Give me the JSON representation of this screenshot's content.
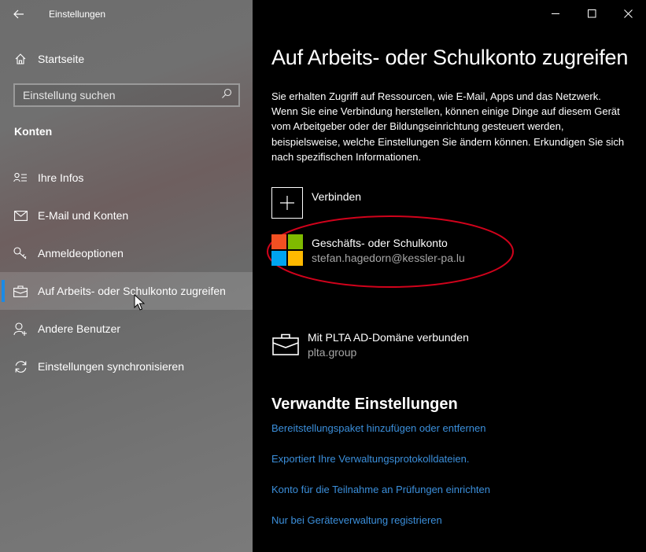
{
  "window": {
    "app_title": "Einstellungen",
    "controls": {
      "minimize": "minimize-icon",
      "maximize": "maximize-icon",
      "close": "close-icon"
    }
  },
  "sidebar": {
    "home_label": "Startseite",
    "search": {
      "placeholder": "Einstellung suchen",
      "value": ""
    },
    "section_heading": "Konten",
    "items": [
      {
        "label": "Ihre Infos",
        "icon": "user-info-icon",
        "selected": false
      },
      {
        "label": "E-Mail und Konten",
        "icon": "mail-icon",
        "selected": false
      },
      {
        "label": "Anmeldeoptionen",
        "icon": "key-icon",
        "selected": false
      },
      {
        "label": "Auf Arbeits- oder Schulkonto zugreifen",
        "icon": "briefcase-icon",
        "selected": true
      },
      {
        "label": "Andere Benutzer",
        "icon": "add-user-icon",
        "selected": false
      },
      {
        "label": "Einstellungen synchronisieren",
        "icon": "sync-icon",
        "selected": false
      }
    ]
  },
  "main": {
    "title": "Auf Arbeits- oder Schulkonto zugreifen",
    "description": "Sie erhalten Zugriff auf Ressourcen, wie E-Mail, Apps und das Netzwerk. Wenn Sie eine Verbindung herstellen, können einige Dinge auf diesem Gerät vom Arbeitgeber oder der Bildungseinrichtung gesteuert werden, beispielsweise, welche Einstellungen Sie ändern können. Erkundigen Sie sich nach spezifischen Informationen.",
    "connect_label": "Verbinden",
    "account": {
      "name": "Geschäfts- oder Schulkonto",
      "email": "stefan.hagedorn@kessler-pa.lu"
    },
    "domain": {
      "name": "Mit PLTA AD-Domäne verbunden",
      "sub": "plta.group"
    },
    "related_heading": "Verwandte Einstellungen",
    "links": [
      "Bereitstellungspaket hinzufügen oder entfernen",
      "Exportiert Ihre Verwaltungsprotokolldateien.",
      "Konto für die Teilnahme an Prüfungen einrichten",
      "Nur bei Geräteverwaltung registrieren"
    ]
  },
  "colors": {
    "accent": "#1a8ae6",
    "link": "#3b8fdb",
    "highlight_ellipse": "#d0021b",
    "ms_red": "#f25022",
    "ms_green": "#7fba00",
    "ms_blue": "#00a4ef",
    "ms_yellow": "#ffb900"
  }
}
